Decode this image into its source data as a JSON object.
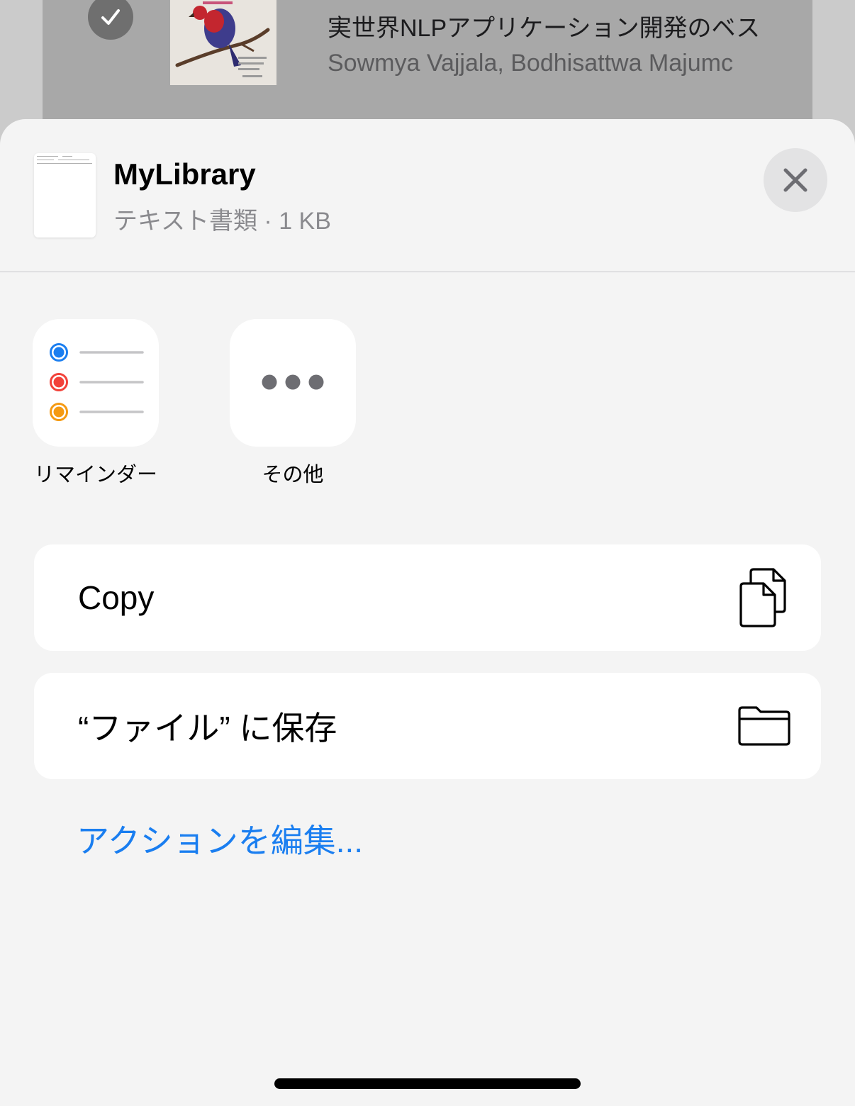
{
  "background_list": {
    "title": "実世界NLPアプリケーション開発のベス",
    "author": "Sowmya Vajjala, Bodhisattwa Majumc"
  },
  "share_sheet": {
    "file_name": "MyLibrary",
    "file_info": "テキスト書類 · 1 KB",
    "apps": [
      {
        "label": "リマインダー",
        "icon": "reminders-icon"
      },
      {
        "label": "その他",
        "icon": "more-icon"
      }
    ],
    "actions": [
      {
        "label": "Copy",
        "icon": "copy-icon"
      },
      {
        "label": "“ファイル” に保存",
        "icon": "folder-icon"
      }
    ],
    "edit_actions_label": "アクションを編集..."
  },
  "colors": {
    "accent": "#1a7ef0",
    "reminder_blue": "#1a7ef0",
    "reminder_red": "#f2423a",
    "reminder_orange": "#f59a12"
  }
}
